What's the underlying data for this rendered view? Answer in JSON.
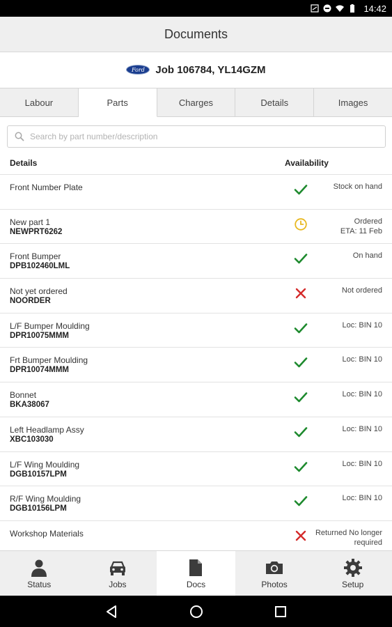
{
  "status_bar": {
    "time": "14:42"
  },
  "header": {
    "title": "Documents"
  },
  "job": {
    "brand": "Ford",
    "title": "Job 106784, YL14GZM"
  },
  "tabs": [
    {
      "label": "Labour"
    },
    {
      "label": "Parts"
    },
    {
      "label": "Charges"
    },
    {
      "label": "Details"
    },
    {
      "label": "Images"
    }
  ],
  "active_tab": "Parts",
  "search": {
    "placeholder": "Search by part number/description",
    "value": ""
  },
  "columns": {
    "details": "Details",
    "availability": "Availability"
  },
  "parts": [
    {
      "name": "Front Number Plate",
      "code": "",
      "icon": "check-icon",
      "status": "Stock on hand",
      "status2": ""
    },
    {
      "name": "New part 1",
      "code": "NEWPRT6262",
      "icon": "clock-icon",
      "status": "Ordered",
      "status2": "ETA: 11 Feb"
    },
    {
      "name": "Front Bumper",
      "code": "DPB102460LML",
      "icon": "check-icon",
      "status": "On hand",
      "status2": ""
    },
    {
      "name": "Not yet ordered",
      "code": "NOORDER",
      "icon": "cross-icon",
      "status": "Not ordered",
      "status2": ""
    },
    {
      "name": "L/F Bumper Moulding",
      "code": "DPR10075MMM",
      "icon": "check-icon",
      "status": "Loc: BIN 10",
      "status2": ""
    },
    {
      "name": "Frt Bumper Moulding",
      "code": "DPR10074MMM",
      "icon": "check-icon",
      "status": "Loc: BIN 10",
      "status2": ""
    },
    {
      "name": "Bonnet",
      "code": "BKA38067",
      "icon": "check-icon",
      "status": "Loc: BIN 10",
      "status2": ""
    },
    {
      "name": "Left Headlamp Assy",
      "code": "XBC103030",
      "icon": "check-icon",
      "status": "Loc: BIN 10",
      "status2": ""
    },
    {
      "name": "L/F Wing Moulding",
      "code": "DGB10157LPM",
      "icon": "check-icon",
      "status": "Loc: BIN 10",
      "status2": ""
    },
    {
      "name": "R/F Wing Moulding",
      "code": "DGB10156LPM",
      "icon": "check-icon",
      "status": "Loc: BIN 10",
      "status2": ""
    },
    {
      "name": "Workshop Materials",
      "code": "",
      "icon": "cross-icon",
      "status": "Returned No longer",
      "status2": "required"
    }
  ],
  "bottom_nav": [
    {
      "label": "Status",
      "icon": "person-icon"
    },
    {
      "label": "Jobs",
      "icon": "car-icon"
    },
    {
      "label": "Docs",
      "icon": "document-icon"
    },
    {
      "label": "Photos",
      "icon": "camera-icon"
    },
    {
      "label": "Setup",
      "icon": "gear-icon"
    }
  ],
  "active_nav": "Docs",
  "colors": {
    "check": "#1e8a2e",
    "cross": "#d42a2a",
    "clock": "#e8b820",
    "icon_dark": "#3c3c3c"
  }
}
